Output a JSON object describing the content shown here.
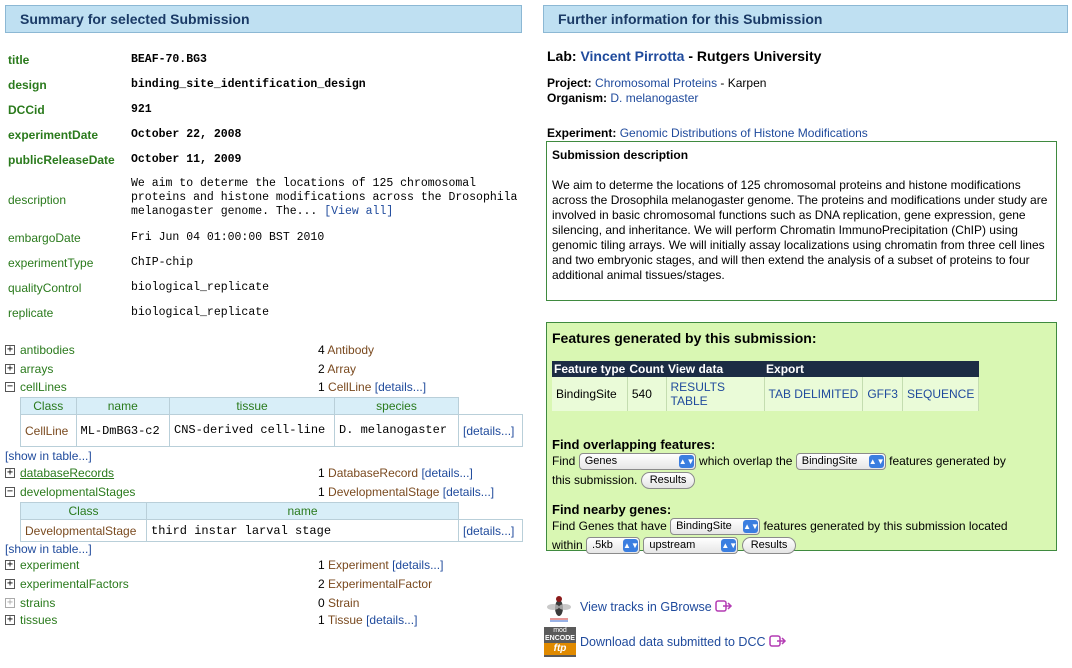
{
  "left_header": "Summary for selected Submission",
  "right_header": "Further information for this Submission",
  "summary": [
    {
      "key": "title",
      "value": "BEAF-70.BG3"
    },
    {
      "key": "design",
      "value": "binding_site_identification_design"
    },
    {
      "key": "DCCid",
      "value": "921"
    },
    {
      "key": "experimentDate",
      "value": "October 22, 2008"
    },
    {
      "key": "publicReleaseDate",
      "value": "October 11, 2009"
    },
    {
      "key": "description",
      "value": "We aim to determe the locations of 125 chromosomal proteins and histone modifications across the Drosophila melanogaster genome. The...",
      "link": "[View all]"
    },
    {
      "key": "embargoDate",
      "value": "Fri Jun 04 01:00:00 BST 2010"
    },
    {
      "key": "experimentType",
      "value": "ChIP-chip"
    },
    {
      "key": "qualityControl",
      "value": "biological_replicate"
    },
    {
      "key": "replicate",
      "value": "biological_replicate"
    }
  ],
  "expandables": {
    "antibodies": {
      "toggle": "+",
      "label": "antibodies",
      "num": "4",
      "type": "Antibody"
    },
    "arrays": {
      "toggle": "+",
      "label": "arrays",
      "num": "2",
      "type": "Array"
    },
    "cellLines": {
      "toggle": "−",
      "label": "cellLines",
      "num": "1",
      "type": "CellLine",
      "details": "[details...]"
    },
    "databaseRecords": {
      "toggle": "+",
      "label": "databaseRecords",
      "num": "1",
      "type": "DatabaseRecord",
      "details": "[details...]"
    },
    "developmentalStages": {
      "toggle": "−",
      "label": "developmentalStages",
      "num": "1",
      "type": "DevelopmentalStage",
      "details": "[details...]"
    },
    "experiment": {
      "toggle": "+",
      "label": "experiment",
      "num": "1",
      "type": "Experiment",
      "details": "[details...]"
    },
    "experimentalFactors": {
      "toggle": "+",
      "label": "experimentalFactors",
      "num": "2",
      "type": "ExperimentalFactor"
    },
    "strains": {
      "toggle": "+",
      "label": "strains",
      "num": "0",
      "type": "Strain"
    },
    "tissues": {
      "toggle": "+",
      "label": "tissues",
      "num": "1",
      "type": "Tissue",
      "details": "[details...]"
    }
  },
  "cellline_table": {
    "headers": [
      "Class",
      "name",
      "tissue",
      "species"
    ],
    "row": {
      "class": "CellLine",
      "name": "ML-DmBG3-c2",
      "tissue": "CNS-derived cell-line",
      "species": "D. melanogaster",
      "details": "[details...]"
    }
  },
  "devstage_table": {
    "headers": [
      "Class",
      "name"
    ],
    "row": {
      "class": "DevelopmentalStage",
      "name": "third instar larval stage",
      "details": "[details...]"
    }
  },
  "show_in_table": "[show in table...]",
  "lab": {
    "prefix": "Lab:",
    "name": "Vincent Pirrotta",
    "sep": " - ",
    "institution": "Rutgers University"
  },
  "project": {
    "prefix": "Project:",
    "name": "Chromosomal Proteins",
    "suffix": " - Karpen"
  },
  "organism": {
    "prefix": "Organism:",
    "name": "D. melanogaster"
  },
  "experiment": {
    "prefix": "Experiment:",
    "name": "Genomic Distributions of Histone Modifications"
  },
  "submission_description": {
    "title": "Submission description",
    "text": "We aim to determe the locations of 125 chromosomal proteins and histone modifications across the Drosophila melanogaster genome. The proteins and modifications under study are involved in basic chromosomal functions such as DNA replication, gene expression, gene silencing, and inheritance. We will perform Chromatin ImmunoPrecipitation (ChIP) using genomic tiling arrays. We will initially assay localizations using chromatin from three cell lines and two embryonic stages, and will then extend the analysis of a subset of proteins to four additional animal tissues/stages."
  },
  "features": {
    "title": "Features generated by this submission:",
    "headers": [
      "Feature type",
      "Count",
      "View data",
      "Export"
    ],
    "row": {
      "type": "BindingSite",
      "count": "540",
      "view": "RESULTS TABLE",
      "export_tab": "TAB DELIMITED",
      "export_gff3": "GFF3",
      "export_seq": "SEQUENCE"
    }
  },
  "overlap": {
    "title": "Find overlapping features:",
    "find": "Find",
    "select1": "Genes",
    "which": "which overlap the",
    "select2": "BindingSite",
    "tail": "features generated by",
    "line2": "this submission.",
    "button": "Results"
  },
  "nearby": {
    "title": "Find nearby genes:",
    "pre": "Find Genes that have",
    "select1": "BindingSite",
    "tail": "features generated by this submission located",
    "within": "within",
    "select_dist": ".5kb",
    "select_dir": "upstream",
    "button": "Results"
  },
  "links": {
    "gbrowse": "View tracks in GBrowse",
    "download": "Download data submitted to DCC",
    "modencode_logo_top": "mod",
    "modencode_logo_mid": "ENCODE",
    "modencode_logo_bottom": "ftp"
  },
  "colors": {
    "header_bg": "#bfe0f2",
    "feature_bg": "#d9f7b3",
    "green": "#2a7a1c",
    "brown": "#7a4a1f",
    "link": "#1f4a9c"
  }
}
